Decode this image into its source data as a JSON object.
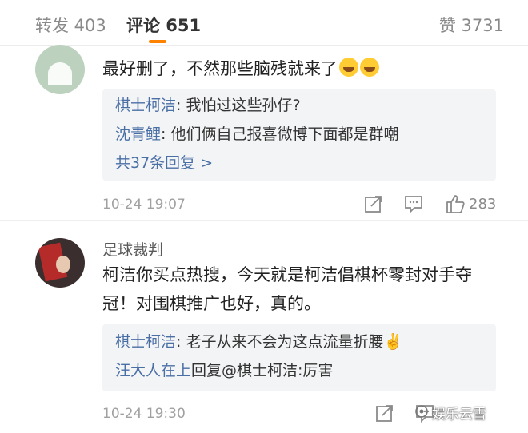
{
  "tabs": {
    "repost": "转发 403",
    "comment": "评论 651",
    "like": "赞 3731"
  },
  "comments": [
    {
      "author": "",
      "text": "最好删了，不然那些脑残就来了",
      "replies": [
        {
          "name": "棋士柯洁",
          "text": ": 我怕过这些孙仔?"
        },
        {
          "name": "沈青鲤",
          "text": ": 他们俩自己报喜微博下面都是群嘲"
        }
      ],
      "reply_count": "共37条回复 >",
      "time": "10-24 19:07",
      "likes": "283"
    },
    {
      "author": "足球裁判",
      "text": "柯洁你买点热搜，今天就是柯洁倡棋杯零封对手夺冠！对围棋推广也好，真的。",
      "replies": [
        {
          "name": "棋士柯洁",
          "text": ": 老子从来不会为这点流量折腰✌️"
        },
        {
          "name": "汪大人在上",
          "text": "回复@棋士柯洁:厉害"
        }
      ],
      "time": "10-24 19:30"
    }
  ],
  "watermark": "娱乐云雪",
  "colors": {
    "accent": "#ff8200",
    "link": "#4a6fa5",
    "reply_bg": "#f3f4f6"
  }
}
